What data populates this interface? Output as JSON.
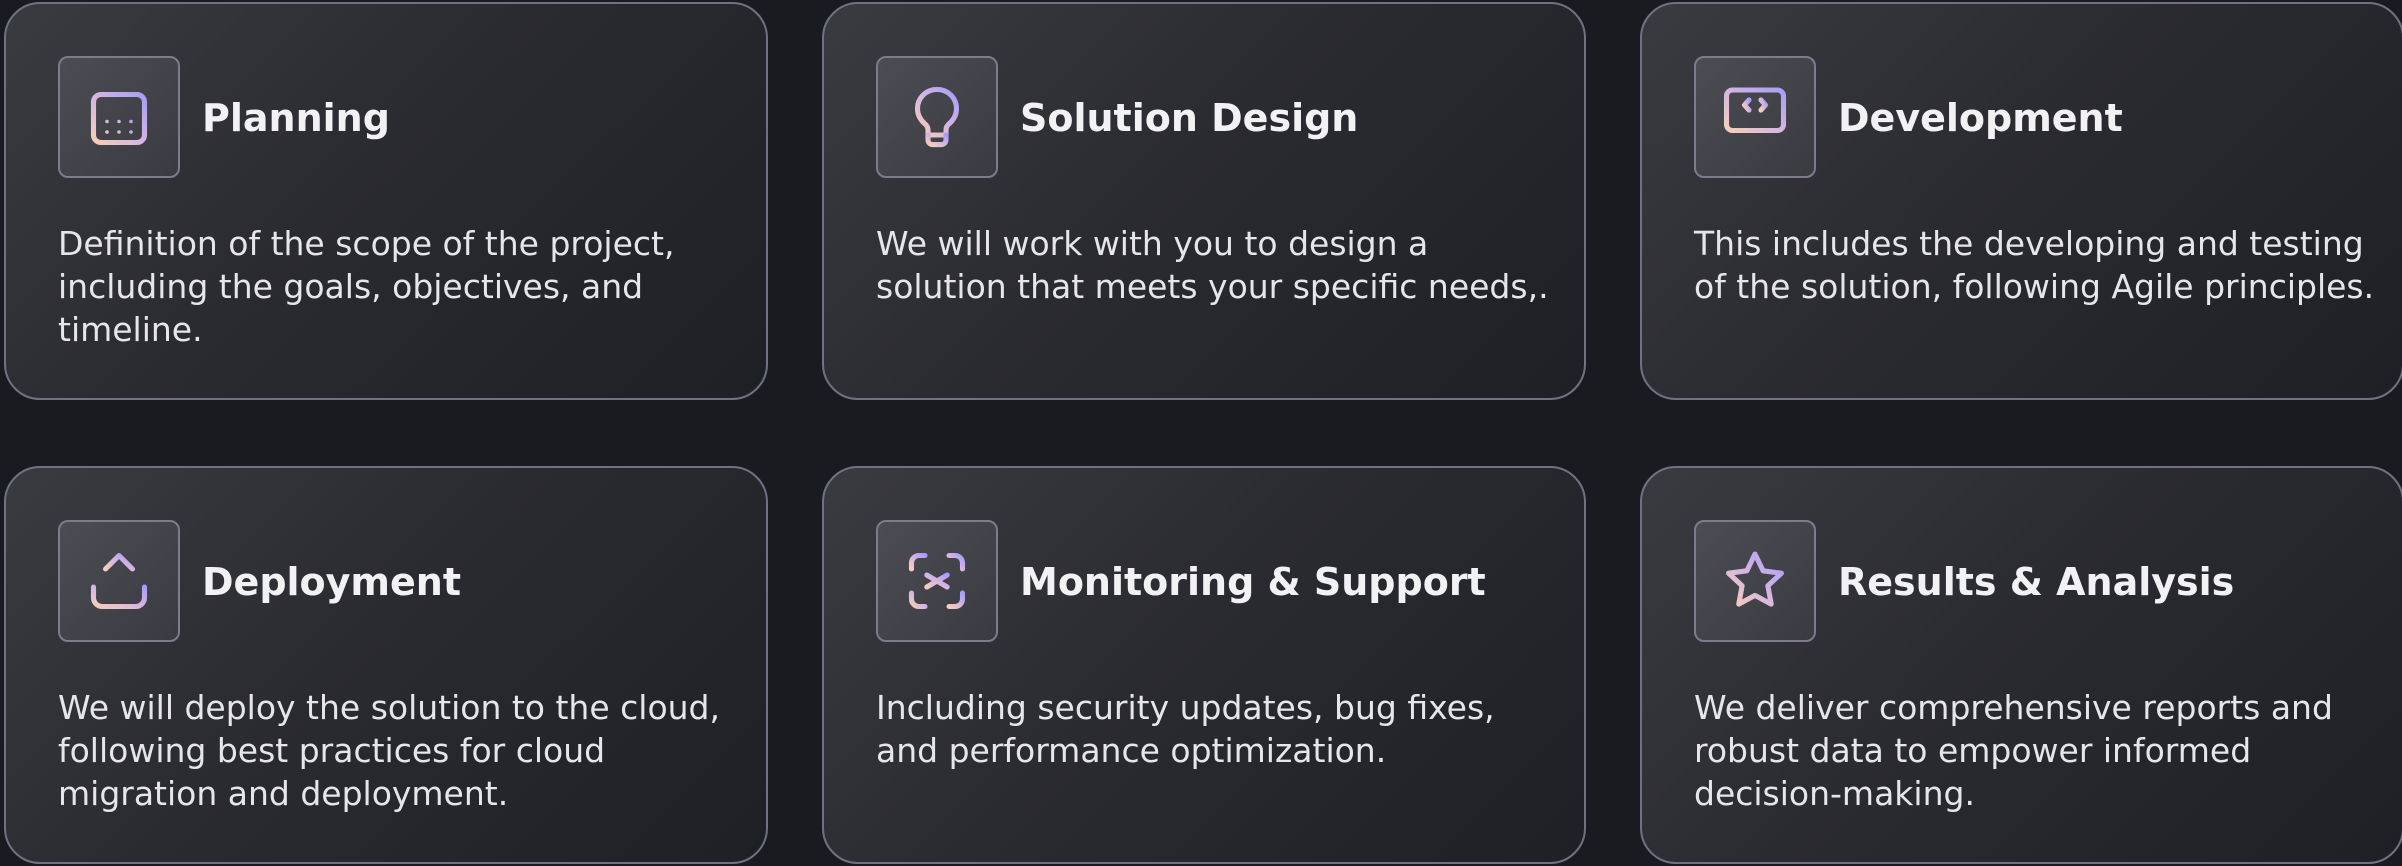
{
  "cards": [
    {
      "icon": "calendar-icon",
      "title": "Planning",
      "description": "Definition of the scope of the project, including the goals, objectives, and timeline."
    },
    {
      "icon": "lightbulb-icon",
      "title": "Solution Design",
      "description": "We will work with you to design a solution that meets your specific needs,."
    },
    {
      "icon": "monitor-code-icon",
      "title": "Development",
      "description": "This includes the developing and testing of the solution, following Agile principles."
    },
    {
      "icon": "upload-icon",
      "title": "Deployment",
      "description": "We will deploy the solution to the cloud, following best practices for cloud migration and deployment."
    },
    {
      "icon": "focus-asterisk-icon",
      "title": "Monitoring & Support",
      "description": "Including security updates, bug fixes, and performance optimization."
    },
    {
      "icon": "star-icon",
      "title": "Results & Analysis",
      "description": "We deliver comprehensive reports and robust data to empower informed decision-making."
    }
  ],
  "colors": {
    "background": "#191b21",
    "card_border": "#6e7283",
    "icon_gradient_start": "#f5c6b8",
    "icon_gradient_end": "#a99cf5",
    "title_text": "#f2f2f5",
    "body_text": "#e6e6ea"
  }
}
